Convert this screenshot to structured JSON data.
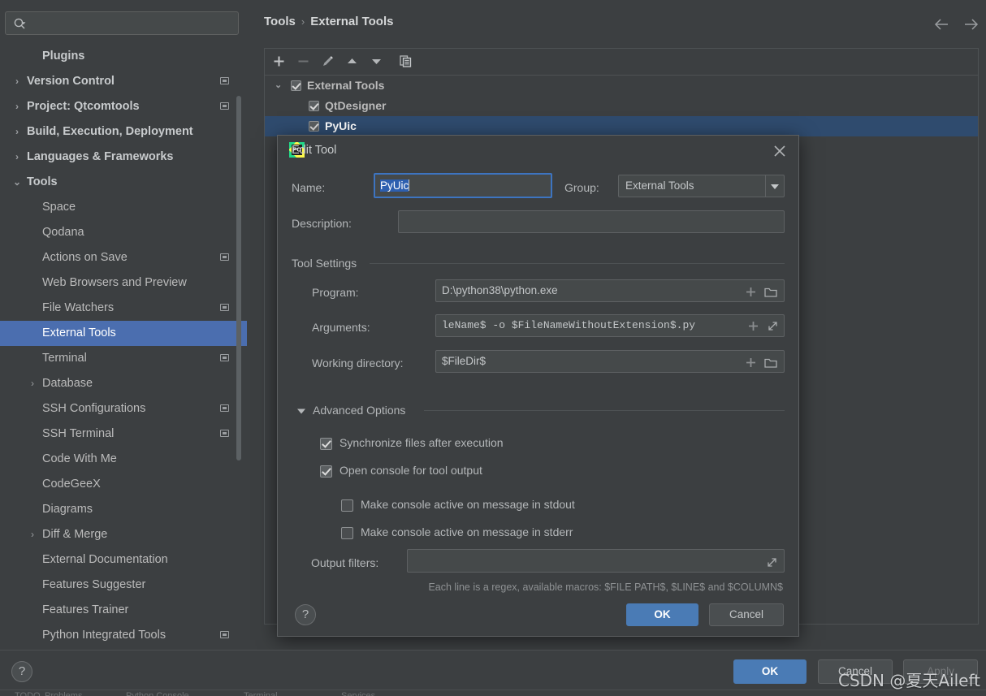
{
  "search": {
    "placeholder": "",
    "value": "",
    "icon": "search-icon"
  },
  "sidebar": {
    "items": [
      {
        "label": "Plugins",
        "indent": 52,
        "arrow": "",
        "bold": true,
        "badge": false,
        "selected": false
      },
      {
        "label": "Version Control",
        "indent": 33,
        "arrow": "›",
        "bold": true,
        "badge": true,
        "selected": false
      },
      {
        "label": "Project: Qtcomtools",
        "indent": 33,
        "arrow": "›",
        "bold": true,
        "badge": true,
        "selected": false
      },
      {
        "label": "Build, Execution, Deployment",
        "indent": 33,
        "arrow": "›",
        "bold": true,
        "badge": false,
        "selected": false
      },
      {
        "label": "Languages & Frameworks",
        "indent": 33,
        "arrow": "›",
        "bold": true,
        "badge": false,
        "selected": false
      },
      {
        "label": "Tools",
        "indent": 33,
        "arrow": "⌄",
        "bold": true,
        "badge": false,
        "selected": false
      },
      {
        "label": "Space",
        "indent": 52,
        "arrow": "",
        "bold": false,
        "badge": false,
        "selected": false
      },
      {
        "label": "Qodana",
        "indent": 52,
        "arrow": "",
        "bold": false,
        "badge": false,
        "selected": false
      },
      {
        "label": "Actions on Save",
        "indent": 52,
        "arrow": "",
        "bold": false,
        "badge": true,
        "selected": false
      },
      {
        "label": "Web Browsers and Preview",
        "indent": 52,
        "arrow": "",
        "bold": false,
        "badge": false,
        "selected": false
      },
      {
        "label": "File Watchers",
        "indent": 52,
        "arrow": "",
        "bold": false,
        "badge": true,
        "selected": false
      },
      {
        "label": "External Tools",
        "indent": 52,
        "arrow": "",
        "bold": false,
        "badge": false,
        "selected": true
      },
      {
        "label": "Terminal",
        "indent": 52,
        "arrow": "",
        "bold": false,
        "badge": true,
        "selected": false
      },
      {
        "label": "Database",
        "indent": 52,
        "arrow": "›",
        "bold": false,
        "badge": false,
        "selected": false
      },
      {
        "label": "SSH Configurations",
        "indent": 52,
        "arrow": "",
        "bold": false,
        "badge": true,
        "selected": false
      },
      {
        "label": "SSH Terminal",
        "indent": 52,
        "arrow": "",
        "bold": false,
        "badge": true,
        "selected": false
      },
      {
        "label": "Code With Me",
        "indent": 52,
        "arrow": "",
        "bold": false,
        "badge": false,
        "selected": false
      },
      {
        "label": "CodeGeeX",
        "indent": 52,
        "arrow": "",
        "bold": false,
        "badge": false,
        "selected": false
      },
      {
        "label": "Diagrams",
        "indent": 52,
        "arrow": "",
        "bold": false,
        "badge": false,
        "selected": false
      },
      {
        "label": "Diff & Merge",
        "indent": 52,
        "arrow": "›",
        "bold": false,
        "badge": false,
        "selected": false
      },
      {
        "label": "External Documentation",
        "indent": 52,
        "arrow": "",
        "bold": false,
        "badge": false,
        "selected": false
      },
      {
        "label": "Features Suggester",
        "indent": 52,
        "arrow": "",
        "bold": false,
        "badge": false,
        "selected": false
      },
      {
        "label": "Features Trainer",
        "indent": 52,
        "arrow": "",
        "bold": false,
        "badge": false,
        "selected": false
      },
      {
        "label": "Python Integrated Tools",
        "indent": 52,
        "arrow": "",
        "bold": false,
        "badge": true,
        "selected": false
      }
    ]
  },
  "breadcrumb": {
    "root": "Tools",
    "sep": "›",
    "leaf": "External Tools"
  },
  "toolbar": {
    "add": "add-icon",
    "remove": "remove-icon",
    "edit": "edit-pencil-icon",
    "up": "move-up-icon",
    "down": "move-down-icon",
    "copy": "copy-icon"
  },
  "tools_tree": [
    {
      "label": "External Tools",
      "level": 0,
      "checked": true,
      "expanded": true,
      "selected": false
    },
    {
      "label": "QtDesigner",
      "level": 1,
      "checked": true,
      "expanded": false,
      "selected": false
    },
    {
      "label": "PyUic",
      "level": 1,
      "checked": true,
      "expanded": false,
      "selected": true
    }
  ],
  "dialog": {
    "title": "Edit Tool",
    "app_icon": "pycharm-icon",
    "close_icon": "close-icon",
    "name_label": "Name:",
    "name_value": "PyUic",
    "group_label": "Group:",
    "group_value": "External Tools",
    "description_label": "Description:",
    "description_value": "",
    "tool_settings_title": "Tool Settings",
    "program_label": "Program:",
    "program_value": "D:\\python38\\python.exe",
    "arguments_label": "Arguments:",
    "arguments_value": "leName$ -o $FileNameWithoutExtension$.py",
    "working_dir_label": "Working directory:",
    "working_dir_value": "$FileDir$",
    "advanced_title": "Advanced Options",
    "advanced_collapse_icon": "chevron-down-icon",
    "checkboxes": [
      {
        "label": "Synchronize files after execution",
        "checked": true,
        "indent": 0
      },
      {
        "label": "Open console for tool output",
        "checked": true,
        "indent": 0
      },
      {
        "label": "Make console active on message in stdout",
        "checked": false,
        "indent": 1
      },
      {
        "label": "Make console active on message in stderr",
        "checked": false,
        "indent": 1
      }
    ],
    "output_filters_label": "Output filters:",
    "output_filters_value": "",
    "hint": "Each line is a regex, available macros: $FILE PATH$, $LINE$ and $COLUMN$",
    "help_label": "?",
    "ok_label": "OK",
    "cancel_label": "Cancel",
    "insert_macro_icon": "plus-icon",
    "browse_icon": "folder-icon",
    "expand_icon": "expand-icon"
  },
  "bottom": {
    "help_label": "?",
    "ok_label": "OK",
    "cancel_label": "Cancel",
    "apply_label": "Apply"
  },
  "status_items": [
    "TODO",
    "Problems",
    "Python Console",
    "Terminal",
    "Services"
  ],
  "watermark": "CSDN @夏天Aileft",
  "colors": {
    "background": "#3c3f41",
    "sidebar_selection": "#4b6eaf",
    "tree_selection": "#2f4b6e",
    "accent_button": "#4a7bb5",
    "annotation_arrow": "#e81a1a",
    "focus_border": "#3d74c0",
    "text_selection": "#2d5faf"
  }
}
